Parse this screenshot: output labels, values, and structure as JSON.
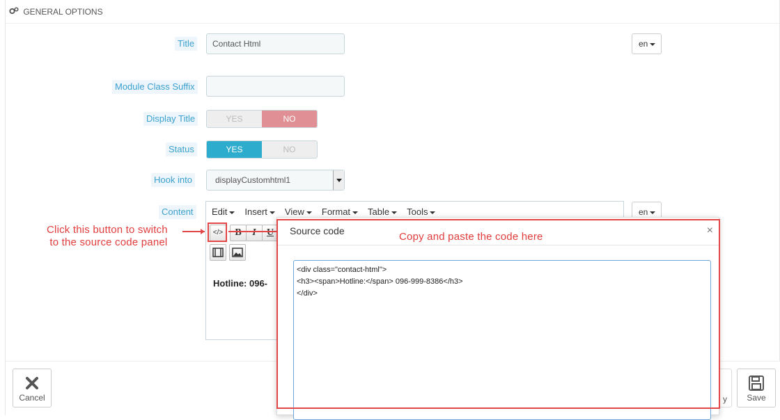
{
  "header": {
    "icon": "cogs-icon",
    "title": "GENERAL OPTIONS"
  },
  "form": {
    "title": {
      "label": "Title",
      "value": "Contact Html",
      "lang": "en"
    },
    "module_class_suffix": {
      "label": "Module Class Suffix",
      "value": ""
    },
    "display_title": {
      "label": "Display Title",
      "yes": "YES",
      "no": "NO",
      "selected": "NO"
    },
    "status": {
      "label": "Status",
      "yes": "YES",
      "no": "NO",
      "selected": "YES"
    },
    "hook_into": {
      "label": "Hook into",
      "value": "displayCustomhtml1"
    },
    "content": {
      "label": "Content",
      "lang": "en",
      "menu": [
        "Edit",
        "Insert",
        "View",
        "Format",
        "Table",
        "Tools"
      ],
      "toolbar": {
        "source": "</>",
        "bold": "B",
        "italic": "I",
        "underline": "U"
      },
      "body_text": "Hotline: 096-"
    }
  },
  "footer": {
    "cancel_label": "Cancel",
    "save_label": "Save",
    "partial_label": "y"
  },
  "modal": {
    "title": "Source code",
    "close": "×",
    "code": "<div class=\"contact-html\">\n<h3><span>Hotline:</span> 096-999-8386</h3>\n</div>"
  },
  "annotations": {
    "left": "Click this button to switch\n to the source code panel",
    "right": "Copy and paste the code here"
  },
  "colors": {
    "accent": "#2eacce",
    "no_active": "#e08f95",
    "annotation_red": "#e24646",
    "label_blue": "#3aa0cf"
  }
}
